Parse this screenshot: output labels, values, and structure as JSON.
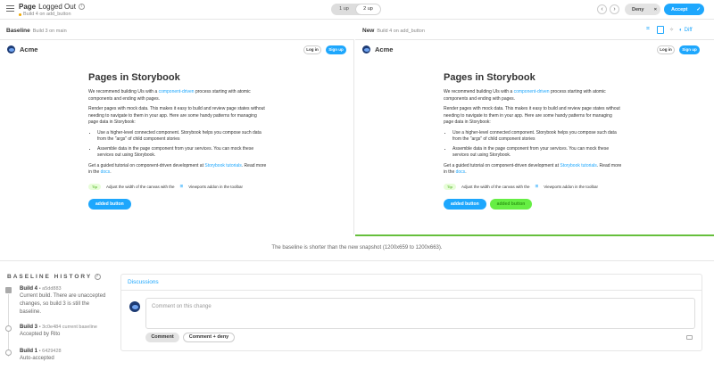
{
  "header": {
    "page_name": "Page",
    "story_name": "Logged Out",
    "subtitle": "Build 4 on add_button",
    "view_modes": [
      "1 up",
      "2 up"
    ],
    "active_view": "2 up",
    "deny_label": "Deny",
    "accept_label": "Accept"
  },
  "baseline_header": {
    "label": "Baseline",
    "detail": "Build 3 on main"
  },
  "new_header": {
    "label": "New",
    "detail": "Build 4 on add_button"
  },
  "tools": {
    "diff_label": "Diff"
  },
  "app": {
    "brand": "Acme",
    "login": "Log in",
    "signup": "Sign up",
    "heading": "Pages in Storybook",
    "p1_pre": "We recommend building UIs with a ",
    "p1_link": "component-driven",
    "p1_post": " process starting with atomic components and ending with pages.",
    "p2": "Render pages with mock data. This makes it easy to build and review page states without needing to navigate to them in your app. Here are some handy patterns for managing page data in Storybook:",
    "li1": "Use a higher-level connected component. Storybook helps you compose such data from the \"args\" of child component stories",
    "li2": "Assemble data in the page component from your services. You can mock these services out using Storybook.",
    "p3_pre": "Get a guided tutorial on component-driven development at ",
    "p3_link": "Storybook tutorials",
    "p3_mid": ". Read more in the ",
    "p3_link2": "docs",
    "p3_post": ".",
    "tip_badge": "Tip",
    "tip_text": "Adjust the width of the canvas with the",
    "tip_text2": "Viewports addon in the toolbar",
    "added_button": "added button",
    "added_button2": "added button"
  },
  "notice": "The baseline is shorter than the new snapshot (1200x659 to 1200x663).",
  "baseline_history": {
    "title": "BASELINE HISTORY",
    "items": [
      {
        "build": "Build 4",
        "hash": "a5dd883",
        "desc": "Current build. There are unaccepted changes, so build 3 is still the baseline."
      },
      {
        "build": "Build 3",
        "hash": "3c0e484 current baseline",
        "desc": "Accepted by Rito"
      },
      {
        "build": "Build 1",
        "hash": "6429428",
        "desc": "Auto-accepted"
      }
    ]
  },
  "discussions": {
    "title": "Discussions",
    "placeholder": "Comment on this change",
    "comment_btn": "Comment",
    "comment_deny_btn": "Comment + deny"
  },
  "colors": {
    "accent": "#1ea7fd",
    "green": "#66bf3c",
    "brand": "#1d3b74"
  }
}
